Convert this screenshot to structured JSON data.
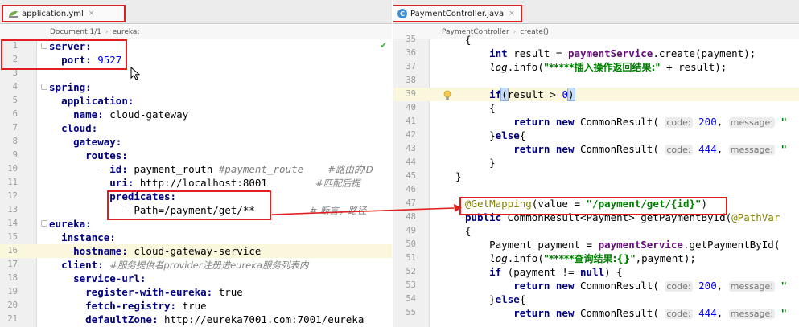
{
  "left_editor": {
    "tab_label": "application.yml",
    "tab_close": "×",
    "breadcrumbs": [
      "Document 1/1",
      "eureka:"
    ],
    "check_mark": "✔",
    "lines": [
      {
        "n": "1"
      },
      {
        "n": "2"
      },
      {
        "n": "3"
      },
      {
        "n": "4"
      },
      {
        "n": "5"
      },
      {
        "n": "6"
      },
      {
        "n": "7"
      },
      {
        "n": "8"
      },
      {
        "n": "9"
      },
      {
        "n": "10"
      },
      {
        "n": "11"
      },
      {
        "n": "12"
      },
      {
        "n": "13"
      },
      {
        "n": "14"
      },
      {
        "n": "15"
      },
      {
        "n": "16"
      },
      {
        "n": "17"
      },
      {
        "n": "18"
      },
      {
        "n": "19"
      },
      {
        "n": "20"
      },
      {
        "n": "21"
      }
    ],
    "code": {
      "l1_key": "server:",
      "l2_key": "port:",
      "l2_val": "9527",
      "l4_key": "spring:",
      "l5_key": "application:",
      "l6_key": "name:",
      "l6_val": "cloud-gateway",
      "l7_key": "cloud:",
      "l8_key": "gateway:",
      "l9_key": "routes:",
      "l10_dash": "- ",
      "l10_key": "id:",
      "l10_val": "payment_routh",
      "l10_cmt": "#payment_route",
      "l10_cmt2": "#路由的ID",
      "l11_key": "uri:",
      "l11_val": "http://localhost:8001",
      "l11_cmt": "#匹配后提",
      "l12_key": "predicates:",
      "l13_val": "- Path=/payment/get/**",
      "l13_cmt": "# 断言，路径",
      "l14_key": "eureka:",
      "l15_key": "instance:",
      "l16_key": "hostname:",
      "l16_val": "cloud-gateway-service",
      "l17_key": "client:",
      "l17_cmt": "#服务提供者provider注册进eureka服务列表内",
      "l18_key": "service-url:",
      "l19_key": "register-with-eureka:",
      "l19_val": "true",
      "l20_key": "fetch-registry:",
      "l20_val": "true",
      "l21_key": "defaultZone:",
      "l21_val": "http://eureka7001.com:7001/eureka"
    }
  },
  "right_editor": {
    "tab_icon_letter": "C",
    "tab_label": "PaymentController.java",
    "tab_close": "×",
    "breadcrumbs": [
      "PaymentController",
      "create()"
    ],
    "lines": [
      {
        "n": "35"
      },
      {
        "n": "36"
      },
      {
        "n": "37"
      },
      {
        "n": "38"
      },
      {
        "n": "39"
      },
      {
        "n": "40"
      },
      {
        "n": "41"
      },
      {
        "n": "42"
      },
      {
        "n": "43"
      },
      {
        "n": "44"
      },
      {
        "n": "45"
      },
      {
        "n": "46"
      },
      {
        "n": "47"
      },
      {
        "n": "48"
      },
      {
        "n": "49"
      },
      {
        "n": "50"
      },
      {
        "n": "51"
      },
      {
        "n": "52"
      },
      {
        "n": "53"
      },
      {
        "n": "54"
      },
      {
        "n": "55"
      }
    ],
    "code": {
      "r35": "{",
      "r36_kw": "int",
      "r36_a": " result = ",
      "r36_fld": "paymentService",
      "r36_b": ".create(payment);",
      "r37_log": "log",
      "r37_a": ".info(",
      "r37_str": "\"*****插入操作返回结果:\"",
      "r37_b": " + result);",
      "r39_kw": "if",
      "r39_paren": "(",
      "r39_a": "result > ",
      "r39_num": "0",
      "r39_close": ")",
      "r40": "{",
      "r41_kw": "return",
      "r41_new": "new",
      "r41_a": " CommonResult(",
      "r41_hint1": "code:",
      "r41_num": "200",
      "r41_c": ",",
      "r41_hint2": "message:",
      "r41_str": "\"",
      "r42_a": "}",
      "r42_kw": "else",
      "r42_b": "{",
      "r43_kw": "return",
      "r43_new": "new",
      "r43_a": " CommonResult(",
      "r43_hint1": "code:",
      "r43_num": "444",
      "r43_c": ",",
      "r43_hint2": "message:",
      "r43_str": "\"",
      "r44": "}",
      "r45": "}",
      "r47_ann": "@GetMapping",
      "r47_a": "(value = ",
      "r47_str": "\"/payment/get/{id}\"",
      "r47_b": ")",
      "r48_kw": "public",
      "r48_a": " CommonResult<Payment> getPaymentById(",
      "r48_ann": "@PathVar",
      "r49": "{",
      "r50_a": "Payment payment = ",
      "r50_fld": "paymentService",
      "r50_b": ".getPaymentById(",
      "r51_log": "log",
      "r51_a": ".info(",
      "r51_str": "\"*****查询结果:{}\"",
      "r51_b": ",payment);",
      "r52_kw": "if",
      "r52_a": " (payment != ",
      "r52_null": "null",
      "r52_b": ") {",
      "r53_kw": "return",
      "r53_new": "new",
      "r53_a": " CommonResult(",
      "r53_hint1": "code:",
      "r53_num": "200",
      "r53_c": ",",
      "r53_hint2": "message:",
      "r53_str": "\"",
      "r54_a": "}",
      "r54_kw": "else",
      "r54_b": "{",
      "r55_kw": "return",
      "r55_new": "new",
      "r55_a": " CommonResult(",
      "r55_hint1": "code:",
      "r55_num": "444",
      "r55_c": ",",
      "r55_hint2": "message:",
      "r55_str": "\""
    }
  },
  "colors": {
    "annotation_box": "#e02020",
    "arrow": "#e02020",
    "current_line": "#fbf7dd",
    "keyword": "#000080",
    "string": "#008000",
    "number": "#0000ff",
    "comment": "#808080"
  },
  "icons": [
    "yml-file-icon",
    "java-class-icon",
    "close-icon",
    "mouse-cursor-icon",
    "lightbulb-icon",
    "check-icon"
  ]
}
